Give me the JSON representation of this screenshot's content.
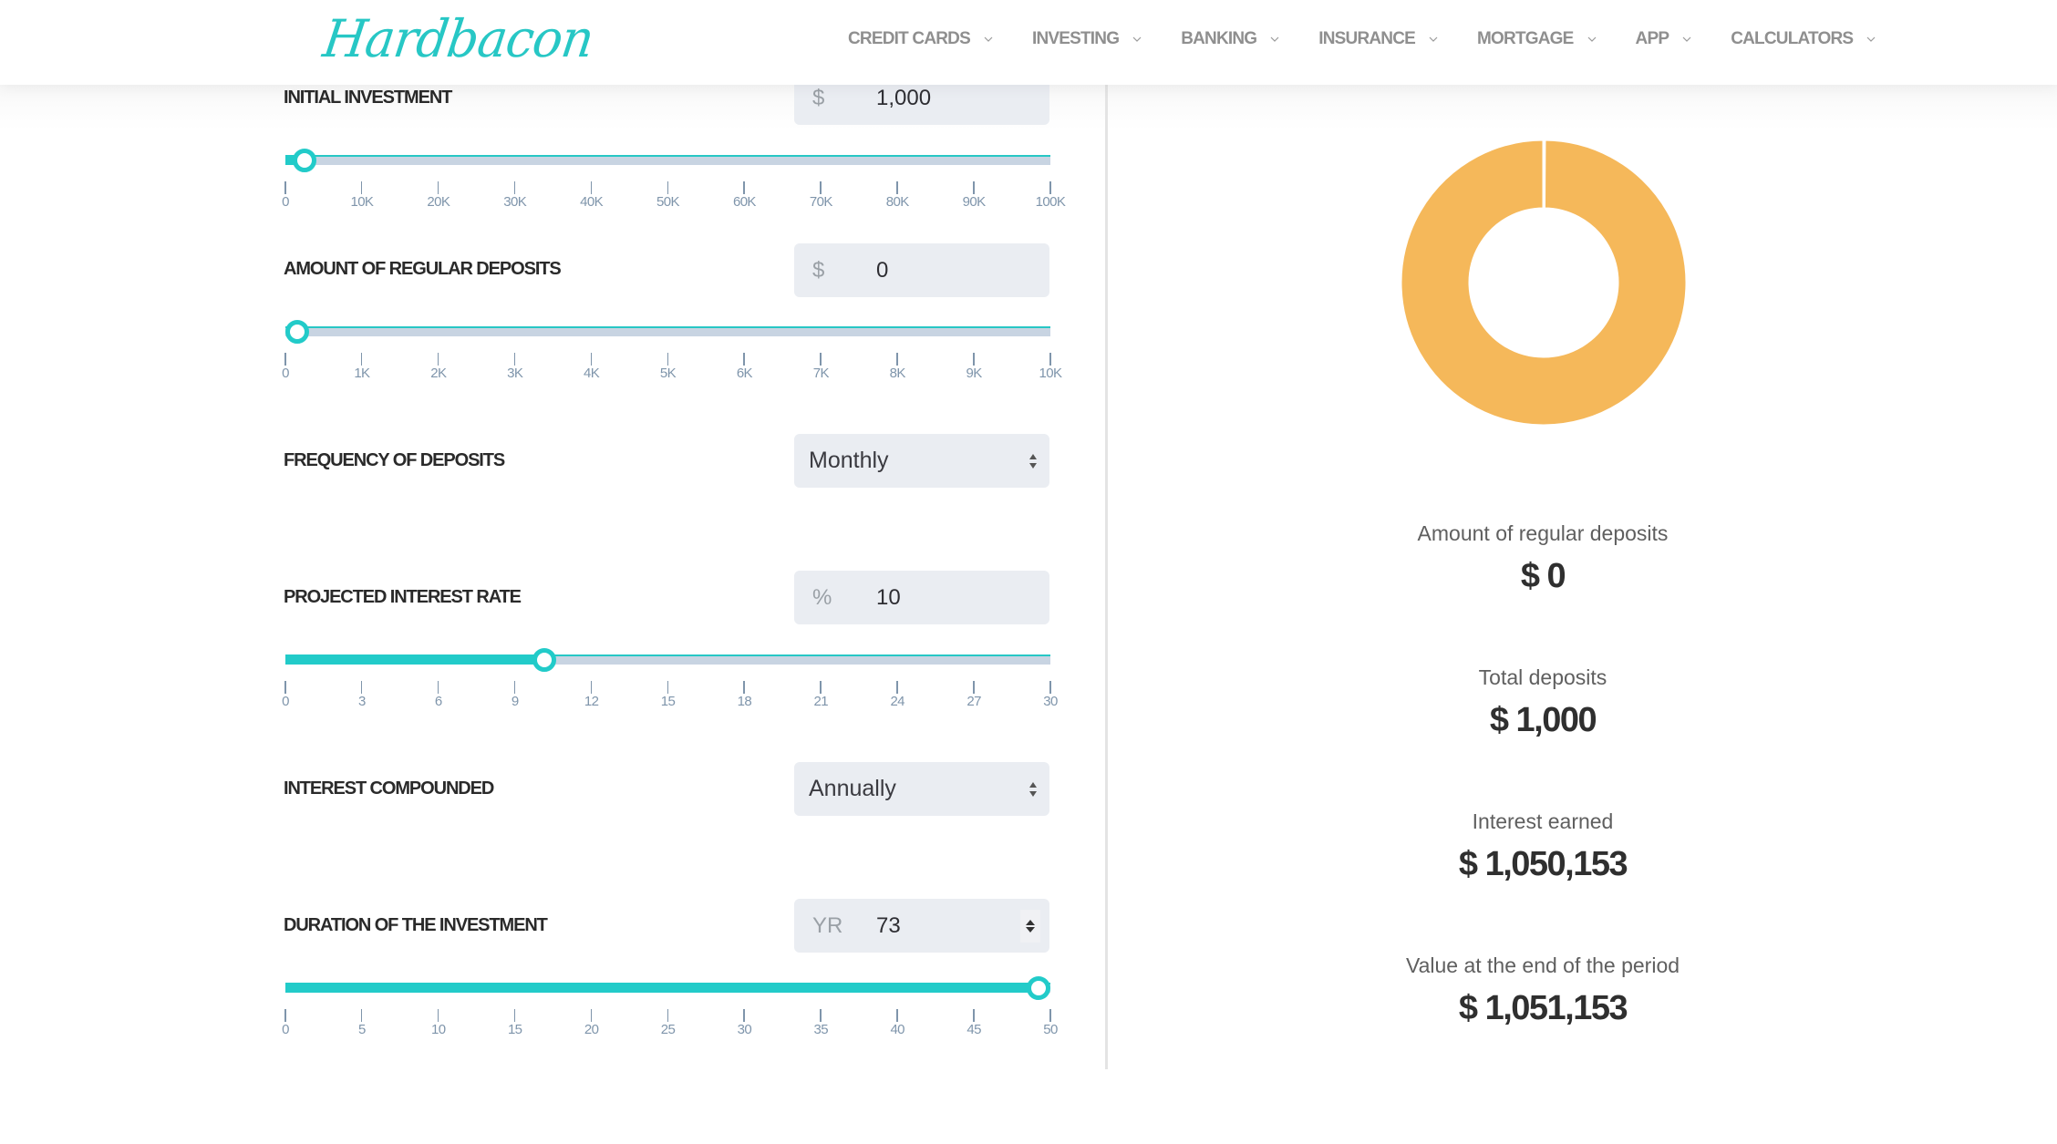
{
  "header": {
    "logo_text": "Hardbacon",
    "nav": [
      {
        "label": "CREDIT CARDS",
        "icon": "chevron-down-icon"
      },
      {
        "label": "INVESTING",
        "icon": "chevron-down-icon"
      },
      {
        "label": "BANKING",
        "icon": "chevron-down-icon"
      },
      {
        "label": "INSURANCE",
        "icon": "chevron-down-icon"
      },
      {
        "label": "MORTGAGE",
        "icon": "chevron-down-icon"
      },
      {
        "label": "APP",
        "icon": "chevron-down-icon"
      },
      {
        "label": "CALCULATORS",
        "icon": "chevron-down-icon"
      }
    ]
  },
  "form": {
    "initial_investment": {
      "label": "INITIAL INVESTMENT",
      "prefix": "$",
      "value": "1,000",
      "slider": {
        "min": 0,
        "max": 100000,
        "value": 1000,
        "ticks": [
          "0",
          "10K",
          "20K",
          "30K",
          "40K",
          "50K",
          "60K",
          "70K",
          "80K",
          "90K",
          "100K"
        ]
      }
    },
    "regular_deposits": {
      "label": "AMOUNT OF REGULAR DEPOSITS",
      "prefix": "$",
      "value": "0",
      "slider": {
        "min": 0,
        "max": 10000,
        "value": 0,
        "ticks": [
          "0",
          "1K",
          "2K",
          "3K",
          "4K",
          "5K",
          "6K",
          "7K",
          "8K",
          "9K",
          "10K"
        ]
      }
    },
    "deposit_frequency": {
      "label": "FREQUENCY OF DEPOSITS",
      "selected": "Monthly"
    },
    "interest_rate": {
      "label": "PROJECTED INTEREST RATE",
      "prefix": "%",
      "value": "10",
      "slider": {
        "min": 0,
        "max": 30,
        "value": 10,
        "ticks": [
          "0",
          "3",
          "6",
          "9",
          "12",
          "15",
          "18",
          "21",
          "24",
          "27",
          "30"
        ]
      }
    },
    "interest_compounded": {
      "label": "INTEREST COMPOUNDED",
      "selected": "Annually"
    },
    "duration": {
      "label": "DURATION OF THE INVESTMENT",
      "prefix": "YR",
      "value": "73",
      "slider": {
        "min": 0,
        "max": 50,
        "value": 50,
        "ticks": [
          "0",
          "5",
          "10",
          "15",
          "20",
          "25",
          "30",
          "35",
          "40",
          "45",
          "50"
        ]
      }
    }
  },
  "results": {
    "stats": [
      {
        "label": "Amount of regular deposits",
        "value": "$ 0"
      },
      {
        "label": "Total deposits",
        "value": "$ 1,000"
      },
      {
        "label": "Interest earned",
        "value": "$ 1,050,153"
      },
      {
        "label": "Value at the end of the period",
        "value": "$ 1,051,153"
      }
    ]
  },
  "colors": {
    "accent": "#22cbc9",
    "donut_interest": "#f5b85a",
    "track": "#c8d4e2",
    "field_bg": "#eaedf2"
  },
  "chart_data": {
    "type": "pie",
    "title": "",
    "donut": true,
    "slices": [
      {
        "name": "Total deposits",
        "value": 1000,
        "color": "#f5b85a"
      },
      {
        "name": "Interest earned",
        "value": 1050153,
        "color": "#f5b85a"
      }
    ]
  }
}
